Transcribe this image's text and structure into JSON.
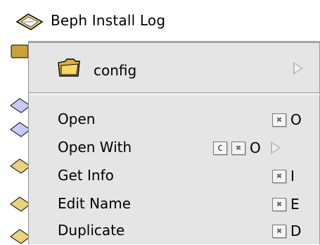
{
  "window": {
    "title": "Beph Install Log"
  },
  "menu": {
    "header": {
      "name": "config"
    },
    "items": [
      {
        "label": "Open",
        "keys": [
          "⌘"
        ],
        "letter": "O"
      },
      {
        "label": "Open With",
        "keys": [
          "C",
          "⌘"
        ],
        "letter": "O",
        "submenu": true
      },
      {
        "label": "Get Info",
        "keys": [
          "⌘"
        ],
        "letter": "I"
      },
      {
        "label": "Edit Name",
        "keys": [
          "⌘"
        ],
        "letter": "E"
      },
      {
        "label": "Duplicate",
        "keys": [
          "⌘"
        ],
        "letter": "D"
      }
    ]
  },
  "icons": [
    "document-icon",
    "folder-icon",
    "submenu-arrow-icon",
    "command-key-icon",
    "control-key-icon"
  ]
}
